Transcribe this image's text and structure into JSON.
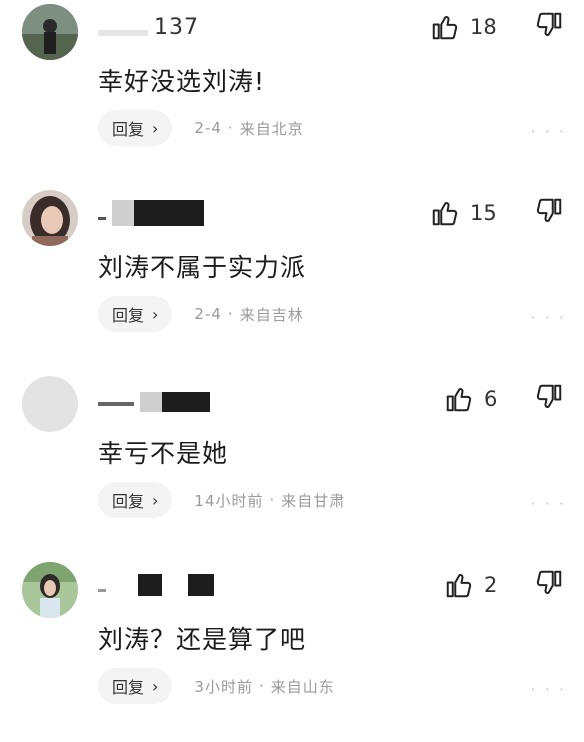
{
  "comments": [
    {
      "username_visible": "137",
      "content": "幸好没选刘涛!",
      "likes": "18",
      "reply_label": "回复",
      "date": "2-4",
      "location": "来自北京",
      "avatar_color": "#5b6b5c"
    },
    {
      "username_visible": "",
      "content": "刘涛不属于实力派",
      "likes": "15",
      "reply_label": "回复",
      "date": "2-4",
      "location": "来自吉林",
      "avatar_color": "#8a6e62"
    },
    {
      "username_visible": "",
      "content": "幸亏不是她",
      "likes": "6",
      "reply_label": "回复",
      "date": "14小时前",
      "location": "来自甘肃",
      "avatar_color": "#e3e3e3"
    },
    {
      "username_visible": "",
      "content": "刘涛？还是算了吧",
      "likes": "2",
      "reply_label": "回复",
      "date": "3小时前",
      "location": "来自山东",
      "avatar_color": "#6f8e5f"
    }
  ],
  "separator": "·",
  "more_glyph": "· · ·"
}
